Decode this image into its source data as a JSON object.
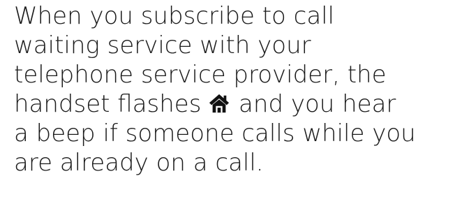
{
  "paragraph": {
    "line1": "When you subscribe to call",
    "line2": "waiting service with your",
    "line3": "telephone service provider, the",
    "line4_before_icon": "handset flashes ",
    "line4_after_icon": " and you hear",
    "line5": "a beep if someone calls while you",
    "line6": "are already on a call.",
    "icon": "home-icon"
  },
  "colors": {
    "text": "#1a1a1a",
    "icon": "#111111",
    "background": "#ffffff"
  }
}
